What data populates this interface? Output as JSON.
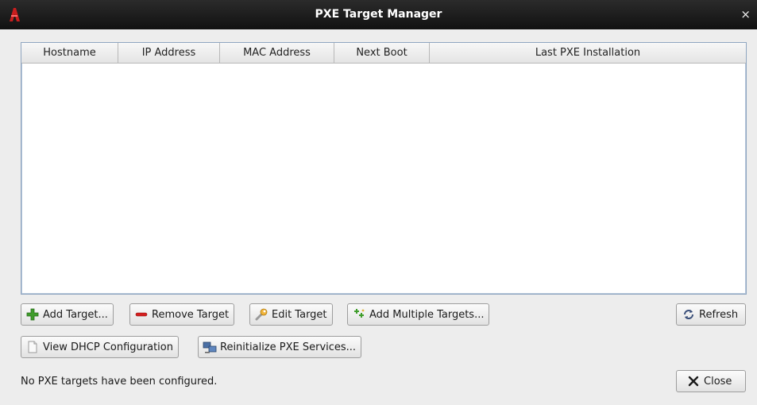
{
  "window": {
    "title": "PXE Target Manager",
    "close_glyph": "×"
  },
  "table": {
    "columns": [
      "Hostname",
      "IP Address",
      "MAC Address",
      "Next Boot",
      "Last PXE Installation"
    ],
    "rows": []
  },
  "buttons": {
    "add_target": "Add Target...",
    "remove_target": "Remove Target",
    "edit_target": "Edit Target",
    "add_multiple": "Add Multiple Targets...",
    "refresh": "Refresh",
    "view_dhcp": "View DHCP Configuration",
    "reinitialize": "Reinitialize PXE Services...",
    "close": "Close"
  },
  "icons": {
    "app": "app-logo-icon",
    "add": "green-plus-icon",
    "remove": "red-minus-icon",
    "edit": "wrench-icon",
    "add_multiple": "multi-plus-icon",
    "refresh": "refresh-icon",
    "view_dhcp": "document-icon",
    "reinitialize": "network-icon",
    "close": "x-icon"
  },
  "status": "No PXE targets have been configured."
}
